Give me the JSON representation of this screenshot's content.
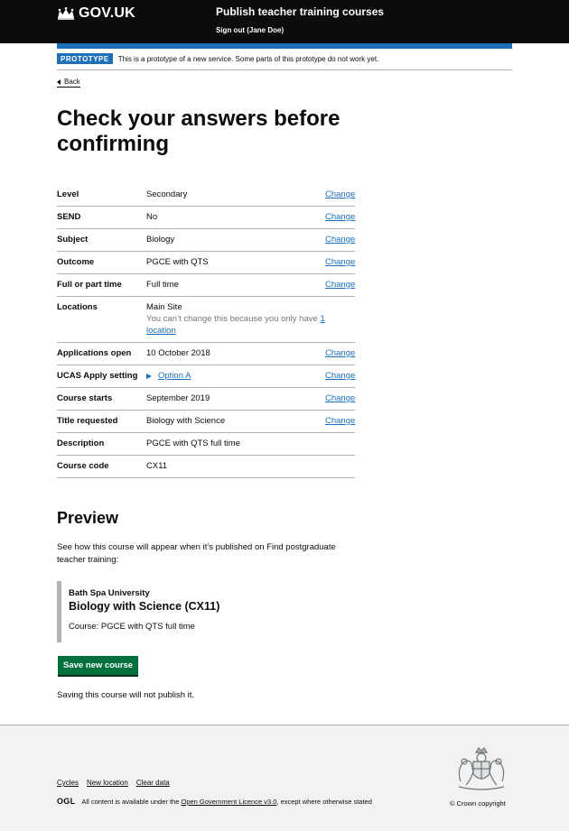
{
  "header": {
    "logo_text": "GOV.UK",
    "service_name": "Publish teacher training courses",
    "signout": "Sign out (Jane Doe)"
  },
  "phase": {
    "tag": "PROTOTYPE",
    "text": "This is a prototype of a new service. Some parts of this prototype do not work yet."
  },
  "back": "Back",
  "title": "Check your answers before confirming",
  "summary": {
    "change_label": "Change",
    "rows": [
      {
        "key": "Level",
        "value": "Secondary"
      },
      {
        "key": "SEND",
        "value": "No"
      },
      {
        "key": "Subject",
        "value": "Biology"
      },
      {
        "key": "Outcome",
        "value": "PGCE with QTS"
      },
      {
        "key": "Full or part time",
        "value": "Full time"
      },
      {
        "key": "Locations",
        "value": "Main Site",
        "hint": "You can’t change this because you only have",
        "hint_link": "1 location"
      },
      {
        "key": "Applications open",
        "value": "10 October 2018"
      },
      {
        "key": "UCAS Apply setting",
        "value": "Option A"
      },
      {
        "key": "Course starts",
        "value": "September 2019"
      },
      {
        "key": "Title requested",
        "value": "Biology with Science"
      },
      {
        "key": "Description",
        "value": "PGCE with QTS full time"
      },
      {
        "key": "Course code",
        "value": "CX11"
      }
    ]
  },
  "preview": {
    "heading": "Preview",
    "description": "See how this course will appear when it’s published on Find postgraduate teacher training:",
    "university": "Bath Spa University",
    "course_title": "Biology with Science (CX11)",
    "course_line": "Course: PGCE with QTS full time"
  },
  "save_button": "Save new course",
  "save_note": "Saving this course will not publish it.",
  "footer": {
    "links": [
      "Cycles",
      "New location",
      "Clear data"
    ],
    "ogl": "OGL",
    "licence_prefix": "All content is available under the",
    "licence_link": "Open Government Licence v3.0",
    "licence_suffix": ", except where otherwise stated",
    "copyright": "© Crown copyright"
  },
  "colors": {
    "header_bg": "#0b0c0c",
    "brand_blue": "#1d70b8",
    "link": "#1d70b8",
    "button_green": "#00703c",
    "footer_bg": "#f3f2f1"
  }
}
